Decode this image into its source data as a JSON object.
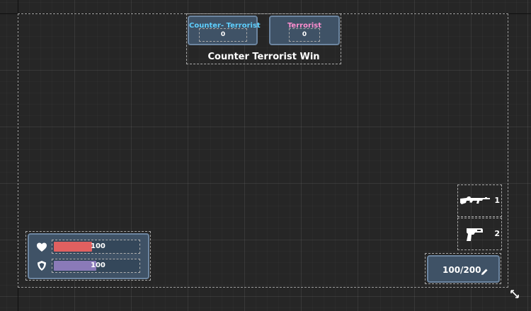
{
  "scoreboard": {
    "ct_label": "Counter- Terrorist",
    "ct_score": "0",
    "t_label": "Terrorist",
    "t_score": "0",
    "round_message": "Counter Terrorist Win"
  },
  "status": {
    "health_value": "100",
    "health_fraction": 0.45,
    "armor_value": "100",
    "armor_fraction": 0.5,
    "health_color": "#e06060",
    "armor_color": "#8a7ab8"
  },
  "weapons": [
    {
      "slot": "1",
      "icon": "rifle-icon"
    },
    {
      "slot": "2",
      "icon": "pistol-icon"
    }
  ],
  "ammo": {
    "display": "100/200",
    "icon": "pencil-icon"
  },
  "colors": {
    "ct_team": "#5fd0ff",
    "t_team": "#ff8fd0",
    "panel": "#3f5266"
  }
}
